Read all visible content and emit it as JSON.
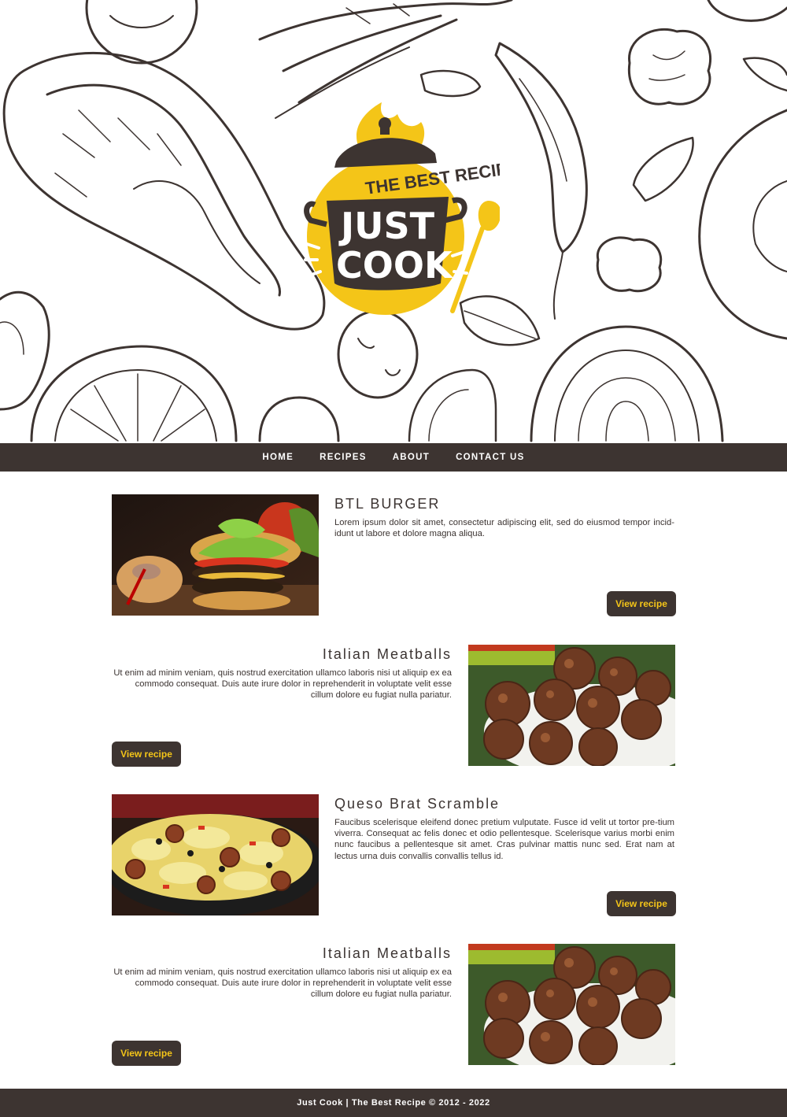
{
  "hero": {
    "logo_tagline": "THE BEST RECIPE",
    "logo_word1": "JUST",
    "logo_word2": "COOK"
  },
  "nav": {
    "items": [
      {
        "label": "HOME"
      },
      {
        "label": "RECIPES"
      },
      {
        "label": "ABOUT"
      },
      {
        "label": "CONTACT US"
      }
    ]
  },
  "recipes": [
    {
      "title": "BTL BURGER",
      "description": "Lorem ipsum dolor sit amet, consectetur adipiscing elit, sed do eiusmod tempor incid-idunt ut labore et dolore magna aliqua.",
      "button": "View recipe",
      "image": "burger-photo"
    },
    {
      "title": "Italian Meatballs",
      "description": "Ut enim ad minim veniam, quis nostrud exercitation ullamco laboris nisi ut aliquip ex ea commodo consequat. Duis aute irure dolor in reprehenderit in voluptate velit esse cillum dolore eu fugiat nulla pariatur.",
      "button": "View recipe",
      "image": "meatballs-photo"
    },
    {
      "title": "Queso Brat Scramble",
      "description": "Faucibus scelerisque eleifend donec pretium vulputate. Fusce id velit ut tortor pre-tium viverra. Consequat ac felis donec et odio pellentesque. Scelerisque varius morbi enim nunc faucibus a pellentesque sit amet. Cras pulvinar mattis nunc sed. Erat nam at lectus urna duis convallis convallis tellus id.",
      "button": "View recipe",
      "image": "scramble-photo"
    },
    {
      "title": "Italian Meatballs",
      "description": "Ut enim ad minim veniam, quis nostrud exercitation ullamco laboris nisi ut aliquip ex ea commodo consequat. Duis aute irure dolor in reprehenderit in voluptate velit esse cillum dolore eu fugiat nulla pariatur.",
      "button": "View recipe",
      "image": "meatballs-photo"
    }
  ],
  "footer": {
    "text": "Just Cook | The Best Recipe © 2012 - 2022"
  },
  "colors": {
    "dark": "#3d3431",
    "accent": "#f4c518",
    "background": "#ffffff"
  }
}
